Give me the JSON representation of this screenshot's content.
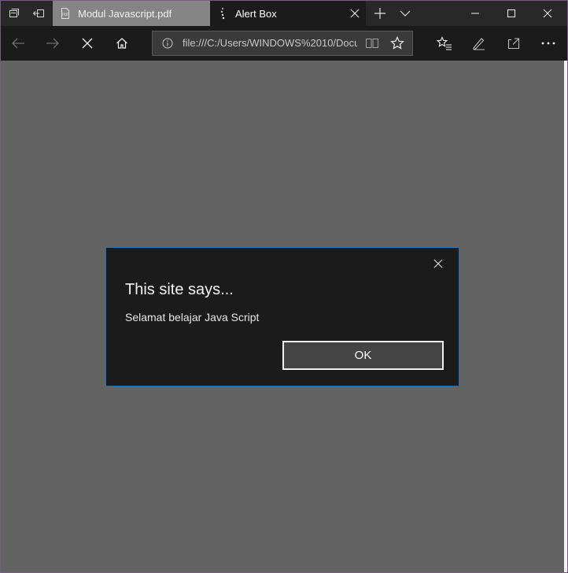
{
  "browser": {
    "tabs": [
      {
        "label": "Modul Javascript.pdf",
        "icon": "pdf-icon",
        "active": false
      },
      {
        "label": "Alert Box",
        "icon": "loading-icon",
        "active": true
      }
    ],
    "address_bar": {
      "url": "file:///C:/Users/WINDOWS%2010/Docu"
    },
    "colors": {
      "titlebar": "#282828",
      "navbar": "#1b1b1b",
      "page_bg": "#636363",
      "dialog_bg": "#1b1b1b",
      "dialog_border": "#1f6fb8"
    }
  },
  "alert": {
    "title": "This site says...",
    "message": "Selamat belajar Java Script",
    "ok_label": "OK"
  }
}
